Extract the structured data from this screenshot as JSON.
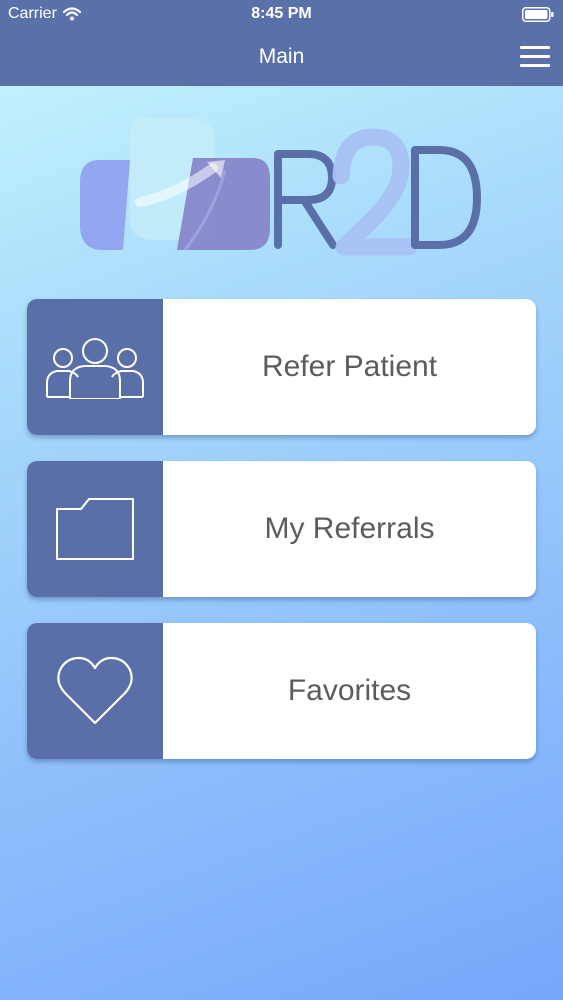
{
  "status_bar": {
    "carrier": "Carrier",
    "time": "8:45 PM"
  },
  "nav": {
    "title": "Main",
    "menu_icon": "hamburger-menu-icon"
  },
  "logo": {
    "text": "R2D",
    "colors": [
      "#8e9ff0",
      "#b3a4e6",
      "#5a6ea8",
      "#a7c1f3"
    ]
  },
  "menu": [
    {
      "label": "Refer Patient",
      "icon": "patients-group-icon"
    },
    {
      "label": "My Referrals",
      "icon": "folder-icon"
    },
    {
      "label": "Favorites",
      "icon": "heart-icon"
    }
  ],
  "colors": {
    "header": "#5a70a9",
    "card_icon_bg": "#5a6ea8",
    "card_text": "#5c5c5c",
    "background_top": "#c8f7fd",
    "background_bottom": "#76a7fb"
  }
}
